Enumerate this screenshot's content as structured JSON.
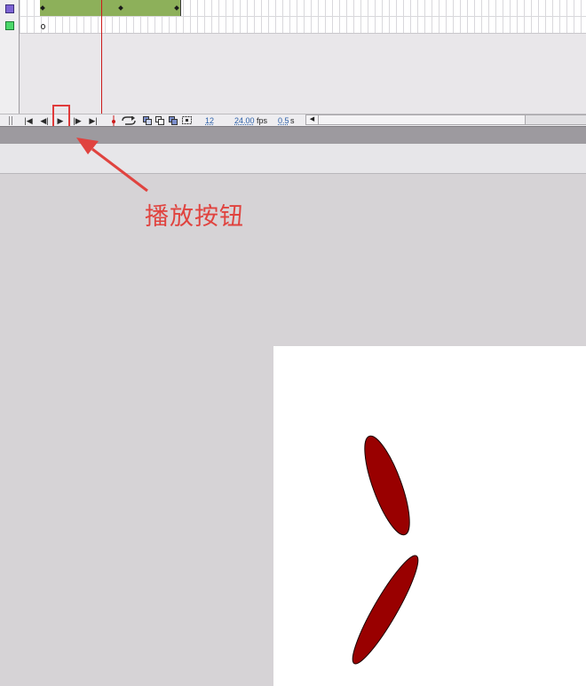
{
  "timeline": {
    "frame_number": "12",
    "frame_rate_value": "24.00",
    "frame_rate_unit": "fps",
    "elapsed_value": "0.5",
    "elapsed_unit": "s",
    "empty_keyframe_glyph": "o"
  },
  "toolbar": {
    "first_frame_icon": "first-frame-icon",
    "step_back_icon": "step-back-icon",
    "play_icon": "play-icon",
    "step_forward_icon": "step-forward-icon",
    "last_frame_icon": "last-frame-icon",
    "first_frame_glyph": "|◀",
    "step_back_glyph": "◀|",
    "play_glyph": "▶",
    "step_forward_glyph": "|▶",
    "last_frame_glyph": "▶|",
    "scroll_left_glyph": "◀"
  },
  "annotation": {
    "label": "播放按钮",
    "color": "#e0433f"
  },
  "colors": {
    "tween": "#8db05a",
    "playhead": "#cc1b1b",
    "shape_fill": "#990000"
  }
}
